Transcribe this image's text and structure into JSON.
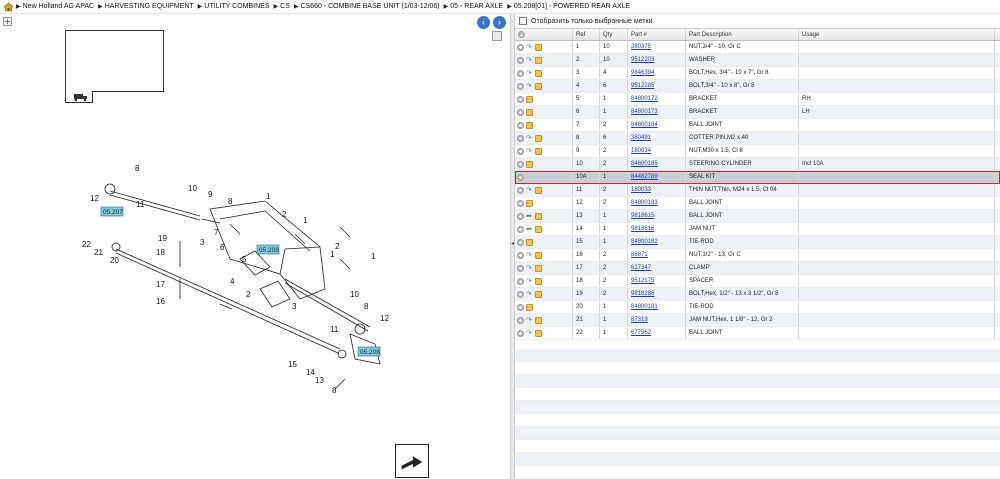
{
  "breadcrumb": [
    "New Holland AG APAC",
    "HARVESTING EQUIPMENT",
    "UTILITY COMBINES",
    "CS",
    "CS660 - COMBINE BASE UNIT (1/03-12/06)",
    "05 - REAR AXLE",
    "05.208[01] - POWERED REAR AXLE"
  ],
  "filter_label": "Отобразить только выбранные метки",
  "columns": {
    "ref": "Ref",
    "qty": "Qty",
    "part": "Part #",
    "desc": "Part Description",
    "usage": "Usage"
  },
  "rows": [
    {
      "ref": "1",
      "qty": "10",
      "part": "280375",
      "desc": "NUT,3/4\" - 10, Gr C",
      "usage": "",
      "icon": "arrow"
    },
    {
      "ref": "2",
      "qty": "10",
      "part": "9512203",
      "desc": "WASHER",
      "usage": "",
      "icon": "arrow"
    },
    {
      "ref": "3",
      "qty": "4",
      "part": "9846394",
      "desc": "BOLT,Hex, 3/4\" - 10 x 7\", Gr 8",
      "usage": "",
      "icon": "arrow"
    },
    {
      "ref": "4",
      "qty": "6",
      "part": "9512285",
      "desc": "BOLT,3/4\" - 10 x 8\", Gr 8",
      "usage": "",
      "icon": "arrow"
    },
    {
      "ref": "5",
      "qty": "1",
      "part": "84800172",
      "desc": "BRACKET",
      "usage": "RH",
      "icon": "none"
    },
    {
      "ref": "6",
      "qty": "1",
      "part": "84800173",
      "desc": "BRACKET",
      "usage": "LH",
      "icon": "none"
    },
    {
      "ref": "7",
      "qty": "2",
      "part": "84800184",
      "desc": "BALL JOINT",
      "usage": "",
      "icon": "none"
    },
    {
      "ref": "8",
      "qty": "6",
      "part": "380491",
      "desc": "COTTER PIN,M2 x 40",
      "usage": "",
      "icon": "arrow"
    },
    {
      "ref": "9",
      "qty": "2",
      "part": "180034",
      "desc": "NUT,M30 x 1.5, Cl 8",
      "usage": "",
      "icon": "arrow"
    },
    {
      "ref": "10",
      "qty": "2",
      "part": "84800185",
      "desc": "STEERING CYLINDER",
      "usage": "Incl 10A",
      "icon": "none"
    },
    {
      "ref": "10A",
      "qty": "1",
      "part": "84482789",
      "desc": "SEAL KIT",
      "usage": "",
      "icon": "none",
      "selected": true
    },
    {
      "ref": "11",
      "qty": "2",
      "part": "180033",
      "desc": "THIN NUT,Thin, M24 x 1.5, Cl 04",
      "usage": "",
      "icon": "arrow"
    },
    {
      "ref": "12",
      "qty": "2",
      "part": "84800183",
      "desc": "BALL JOINT",
      "usage": "",
      "icon": "none"
    },
    {
      "ref": "13",
      "qty": "1",
      "part": "9818615",
      "desc": "BALL JOINT",
      "usage": "",
      "icon": "green"
    },
    {
      "ref": "14",
      "qty": "1",
      "part": "9818616",
      "desc": "JAM NUT",
      "usage": "",
      "icon": "green"
    },
    {
      "ref": "15",
      "qty": "1",
      "part": "84800182",
      "desc": "TIE-ROD",
      "usage": "",
      "icon": "none"
    },
    {
      "ref": "16",
      "qty": "2",
      "part": "88871",
      "desc": "NUT,1/2\" - 13, Gr C",
      "usage": "",
      "icon": "arrow"
    },
    {
      "ref": "17",
      "qty": "2",
      "part": "627347",
      "desc": "CLAMP",
      "usage": "",
      "icon": "arrow"
    },
    {
      "ref": "18",
      "qty": "2",
      "part": "9512175",
      "desc": "SPACER",
      "usage": "",
      "icon": "arrow"
    },
    {
      "ref": "19",
      "qty": "2",
      "part": "9818286",
      "desc": "BOLT,Hex, 1/2\" - 13 x 3 1/2\", Gr 8",
      "usage": "",
      "icon": "arrow"
    },
    {
      "ref": "20",
      "qty": "1",
      "part": "84800181",
      "desc": "TIE-ROD",
      "usage": "",
      "icon": "none"
    },
    {
      "ref": "21",
      "qty": "1",
      "part": "87319",
      "desc": "JAM NUT,Hex, 1 1/8\" - 12, Gr 2",
      "usage": "",
      "icon": "arrow"
    },
    {
      "ref": "22",
      "qty": "1",
      "part": "677962",
      "desc": "BALL JOINT",
      "usage": "",
      "icon": "arrow"
    }
  ],
  "diagram": {
    "callouts": [
      "8",
      "10",
      "9",
      "12",
      "11",
      "8",
      "1",
      "2",
      "1",
      "3",
      "22",
      "21",
      "20",
      "19",
      "18",
      "17",
      "16",
      "7",
      "6",
      "5",
      "4",
      "2",
      "3",
      "1",
      "2",
      "1",
      "10",
      "8",
      "12",
      "11",
      "15",
      "14",
      "13",
      "8"
    ],
    "refs": [
      "05.207",
      "05.208",
      "05.208"
    ]
  },
  "colors": {
    "selected_outline": "#e21f1f",
    "link": "#1a3fb8",
    "nav": "#3b74c6"
  }
}
